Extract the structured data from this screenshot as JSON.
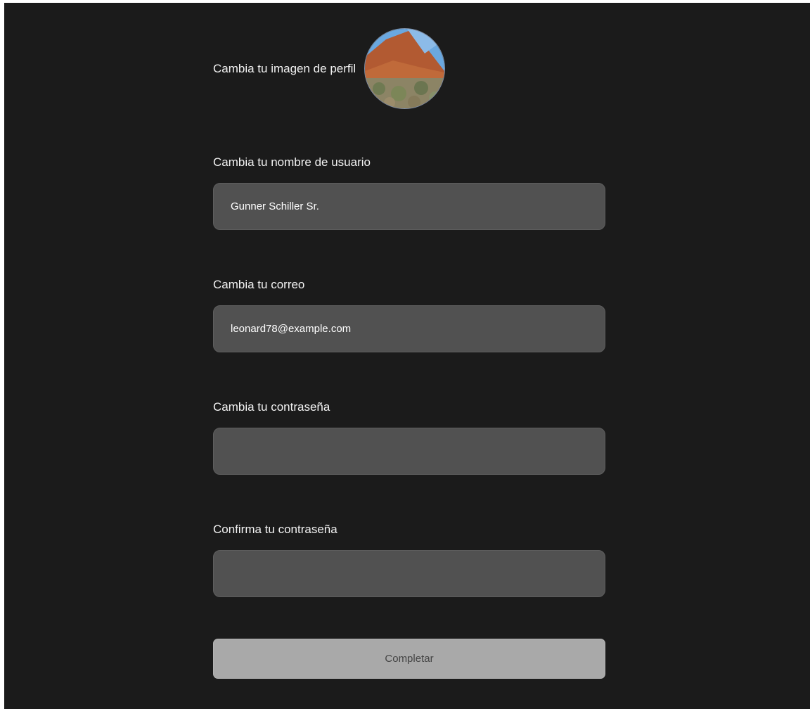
{
  "profile": {
    "label": "Cambia tu imagen de perfil",
    "avatar_icon": "profile-photo-desert-rock"
  },
  "username": {
    "label": "Cambia tu nombre de usuario",
    "value": "Gunner Schiller Sr."
  },
  "email": {
    "label": "Cambia tu correo",
    "value": "leonard78@example.com"
  },
  "password": {
    "label": "Cambia tu contraseña",
    "value": ""
  },
  "confirm_password": {
    "label": "Confirma tu contraseña",
    "value": ""
  },
  "submit": {
    "label": "Completar"
  },
  "colors": {
    "background": "#1b1b1b",
    "field": "#515151",
    "button": "#a9a9a9",
    "text": "#f2f2f2"
  }
}
